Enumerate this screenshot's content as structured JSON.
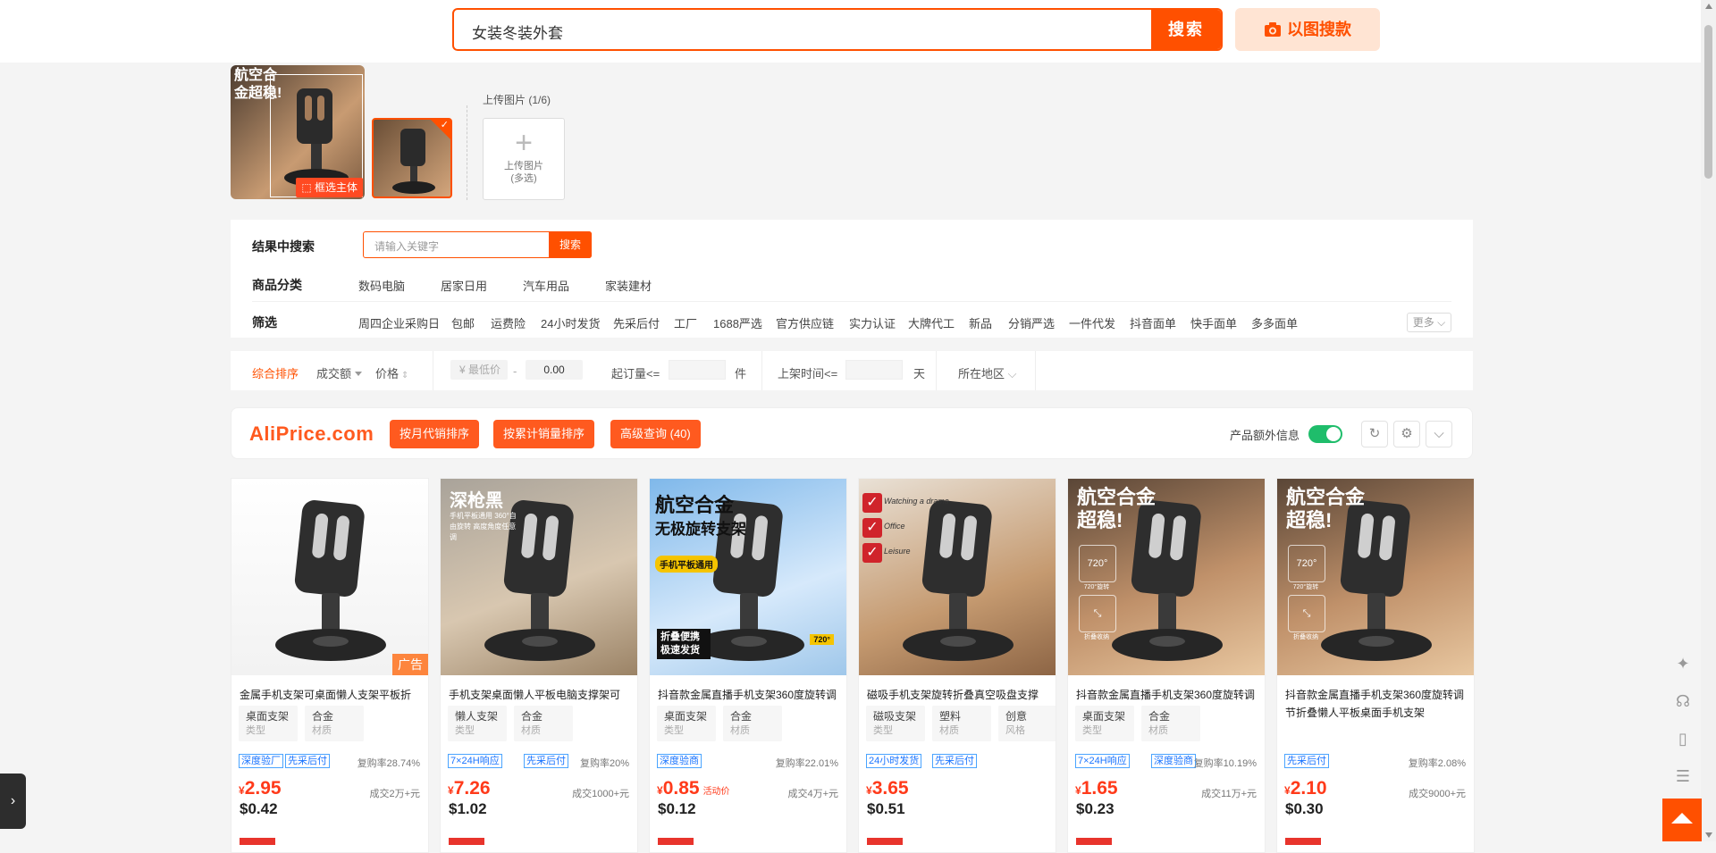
{
  "header": {
    "search_query": "女装冬装外套",
    "search_button": "搜索",
    "image_search_button": "以图搜款"
  },
  "upload": {
    "main_thumb_text": "航空合金超稳!",
    "frame_subject_button": "框选主体",
    "upload_title": "上传图片 (1/6)",
    "upload_box_label_1": "上传图片",
    "upload_box_label_2": "(多选)"
  },
  "filters": {
    "in_result_label": "结果中搜索",
    "in_result_placeholder": "请输入关键字",
    "in_result_button": "搜索",
    "category_label": "商品分类",
    "categories": [
      "数码电脑",
      "居家日用",
      "汽车用品",
      "家装建材"
    ],
    "filter_label": "筛选",
    "filter_items": [
      "周四企业采购日",
      "包邮",
      "运费险",
      "24小时发货",
      "先采后付",
      "工厂",
      "1688严选",
      "官方供应链",
      "实力认证",
      "大牌代工",
      "新品",
      "分销严选",
      "一件代发",
      "抖音面单",
      "快手面单",
      "多多面单"
    ],
    "more_button": "更多"
  },
  "sort": {
    "composite": "综合排序",
    "volume": "成交额",
    "price": "价格",
    "min_price_placeholder": "¥ 最低价",
    "dash": "-",
    "max_price_value": "0.00",
    "moq_label": "起订量<=",
    "moq_unit": "件",
    "listed_label": "上架时间<=",
    "listed_unit": "天",
    "region": "所在地区"
  },
  "aliprice": {
    "logo": "AliPrice.com",
    "btn_monthly": "按月代销排序",
    "btn_cumulative": "按累计销量排序",
    "btn_advanced": "高级查询 (40)",
    "extra_info_label": "产品额外信息",
    "extra_info_enabled": true
  },
  "products": [
    {
      "title": "金属手机支架可桌面懒人支架平板折",
      "attrs": [
        {
          "v": "桌面支架",
          "k": "类型"
        },
        {
          "v": "合金",
          "k": "材质"
        }
      ],
      "tags": [
        "深度验厂",
        "先采后付"
      ],
      "repurchase": "复购率28.74%",
      "price_num": "2.95",
      "promo": "",
      "sold": "成交2万+元",
      "usd": "$0.42",
      "ad_label": "广告",
      "overlay": ""
    },
    {
      "title": "手机支架桌面懒人平板电脑支撑架可",
      "attrs": [
        {
          "v": "懒人支架",
          "k": "类型"
        },
        {
          "v": "合金",
          "k": "材质"
        }
      ],
      "tags": [
        "7×24H响应",
        "先采后付"
      ],
      "repurchase": "复购率20%",
      "price_num": "7.26",
      "promo": "",
      "sold": "成交1000+元",
      "usd": "$1.02",
      "overlay": "深枪黑",
      "overlay_small": "手机平板通用 360°自由旋转 高度角度任意调"
    },
    {
      "title": "抖音款金属直播手机支架360度旋转调",
      "attrs": [
        {
          "v": "桌面支架",
          "k": "类型"
        },
        {
          "v": "合金",
          "k": "材质"
        }
      ],
      "tags": [
        "深度验商"
      ],
      "repurchase": "复购率22.01%",
      "price_num": "0.85",
      "promo": "活动价",
      "sold": "成交4万+元",
      "usd": "$0.12",
      "overlay": "航空合金",
      "overlay2": "无极旋转支架",
      "overlay3": "手机平板通用",
      "overlay4": "折叠便携 极速发货",
      "overlay_badge": "720°"
    },
    {
      "title": "磁吸手机支架旋转折叠真空吸盘支撑",
      "attrs": [
        {
          "v": "磁吸支架",
          "k": "类型"
        },
        {
          "v": "塑料",
          "k": "材质"
        },
        {
          "v": "创意",
          "k": "风格"
        }
      ],
      "tags": [
        "24小时发货",
        "先采后付"
      ],
      "repurchase": "",
      "price_num": "3.65",
      "promo": "",
      "sold": "",
      "usd": "$0.51",
      "overlay": "",
      "checks": [
        "Watching a drama",
        "Office",
        "Leisure"
      ]
    },
    {
      "title": "抖音款金属直播手机支架360度旋转调",
      "attrs": [
        {
          "v": "桌面支架",
          "k": "类型"
        },
        {
          "v": "合金",
          "k": "材质"
        }
      ],
      "tags": [
        "7×24H响应",
        "深度验商"
      ],
      "repurchase": "复购率10.19%",
      "price_num": "1.65",
      "promo": "",
      "sold": "成交11万+元",
      "usd": "$0.23",
      "overlay": "航空合金",
      "overlay2": "超稳!",
      "icons": [
        "720°",
        "720°旋转",
        "折叠收纳"
      ]
    },
    {
      "title": "抖音款金属直播手机支架360度旋转调节折叠懒人平板桌面手机支架",
      "attrs": [],
      "tags": [
        "先采后付"
      ],
      "repurchase": "复购率2.08%",
      "price_num": "2.10",
      "promo": "",
      "sold": "成交9000+元",
      "usd": "$0.30",
      "overlay": "航空合金",
      "overlay2": "超稳!",
      "icons": [
        "720°",
        "720°旋转",
        "折叠收纳"
      ]
    }
  ],
  "currency_symbol": "¥",
  "colors": {
    "accent": "#ff5000",
    "aliprice": "#ff5a1f",
    "tag_blue": "#1a74ff",
    "toggle_on": "#1fbd6b"
  }
}
